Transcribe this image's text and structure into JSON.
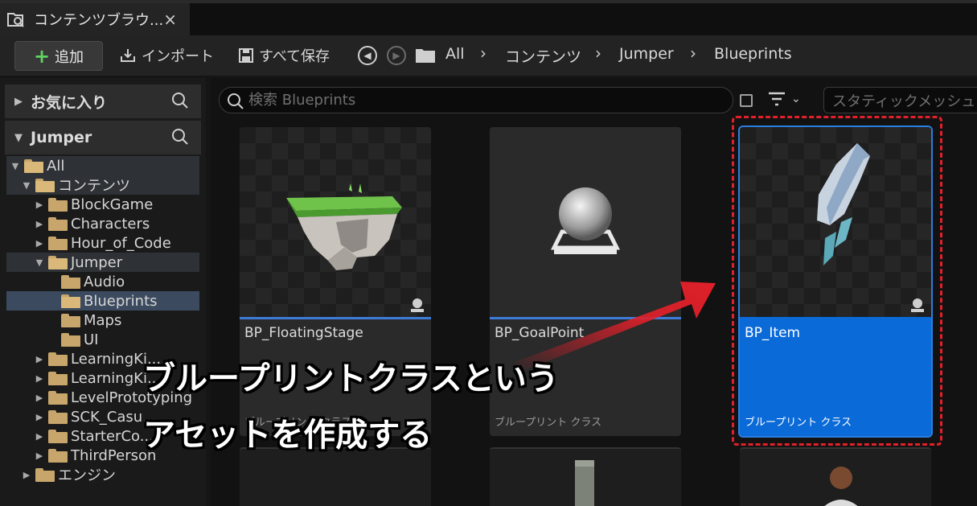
{
  "tab": {
    "title": "コンテンツブラウ...",
    "close": "×"
  },
  "toolbar": {
    "add_label": "追加",
    "import_label": "インポート",
    "save_all_label": "すべて保存",
    "breadcrumbs": [
      "All",
      "コンテンツ",
      "Jumper",
      "Blueprints"
    ]
  },
  "sidebar": {
    "favorites_title": "お気に入り",
    "project_title": "Jumper",
    "tree": [
      {
        "label": "All",
        "depth": 0,
        "expanded": true
      },
      {
        "label": "コンテンツ",
        "depth": 1,
        "expanded": true
      },
      {
        "label": "BlockGame",
        "depth": 2,
        "expanded": false
      },
      {
        "label": "Characters",
        "depth": 2,
        "expanded": false
      },
      {
        "label": "Hour_of_Code",
        "depth": 2,
        "expanded": false
      },
      {
        "label": "Jumper",
        "depth": 2,
        "expanded": true
      },
      {
        "label": "Audio",
        "depth": 3
      },
      {
        "label": "Blueprints",
        "depth": 3,
        "selected": true
      },
      {
        "label": "Maps",
        "depth": 3
      },
      {
        "label": "UI",
        "depth": 3
      },
      {
        "label": "LearningKi...",
        "depth": 2,
        "expanded": false
      },
      {
        "label": "LearningKi...",
        "depth": 2,
        "expanded": false
      },
      {
        "label": "LevelPrototyping",
        "depth": 2,
        "expanded": false
      },
      {
        "label": "SCK_Casu...",
        "depth": 2,
        "expanded": false
      },
      {
        "label": "StarterCo...",
        "depth": 2,
        "expanded": false
      },
      {
        "label": "ThirdPerson",
        "depth": 2,
        "expanded": false
      },
      {
        "label": "エンジン",
        "depth": 1,
        "expanded": false
      }
    ]
  },
  "content": {
    "search_placeholder": "検索 Blueprints",
    "filter_chip": "スタティックメッシュ",
    "assets": [
      {
        "name": "BP_FloatingStage",
        "type": "ブループリント クラス",
        "selected": false
      },
      {
        "name": "BP_GoalPoint",
        "type": "ブループリント クラス",
        "selected": false
      },
      {
        "name": "BP_Item",
        "type": "ブループリント クラス",
        "selected": true
      }
    ]
  },
  "annotation": {
    "line1": "ブループリントクラスという",
    "line2": "アセットを作成する",
    "arrow_color": "#e0202a"
  },
  "colors": {
    "accent": "#0a6ad8",
    "selection_sidebar": "#3b4a5e",
    "folder": "#c8a56a"
  }
}
